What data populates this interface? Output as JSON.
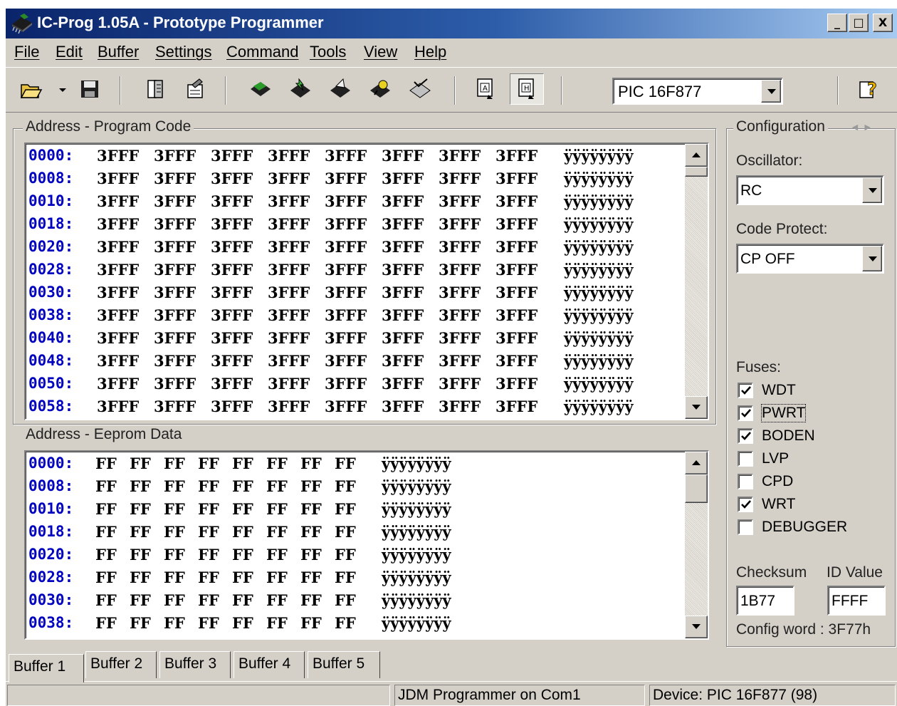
{
  "window": {
    "title": "IC-Prog 1.05A - Prototype Programmer",
    "caption_buttons": [
      "_",
      "□",
      "X"
    ]
  },
  "menu": [
    "File",
    "Edit",
    "Buffer",
    "Settings",
    "Command",
    "Tools",
    "View",
    "Help"
  ],
  "toolbar": {
    "icons": [
      "open-file-icon",
      "open-dropdown-icon",
      "save-icon",
      "read-file-icon",
      "write-file-icon",
      "read-device-icon",
      "program-device-icon",
      "erase-device-icon",
      "verify-device-icon",
      "blank-check-icon",
      "view-asm-icon",
      "view-hex-icon",
      "help-icon"
    ],
    "device": "PIC 16F877"
  },
  "program_code": {
    "title": "Address - Program Code",
    "rows": [
      {
        "addr": "0000:",
        "words": [
          "3FFF",
          "3FFF",
          "3FFF",
          "3FFF",
          "3FFF",
          "3FFF",
          "3FFF",
          "3FFF"
        ],
        "ascii": "ÿÿÿÿÿÿÿÿ"
      },
      {
        "addr": "0008:",
        "words": [
          "3FFF",
          "3FFF",
          "3FFF",
          "3FFF",
          "3FFF",
          "3FFF",
          "3FFF",
          "3FFF"
        ],
        "ascii": "ÿÿÿÿÿÿÿÿ"
      },
      {
        "addr": "0010:",
        "words": [
          "3FFF",
          "3FFF",
          "3FFF",
          "3FFF",
          "3FFF",
          "3FFF",
          "3FFF",
          "3FFF"
        ],
        "ascii": "ÿÿÿÿÿÿÿÿ"
      },
      {
        "addr": "0018:",
        "words": [
          "3FFF",
          "3FFF",
          "3FFF",
          "3FFF",
          "3FFF",
          "3FFF",
          "3FFF",
          "3FFF"
        ],
        "ascii": "ÿÿÿÿÿÿÿÿ"
      },
      {
        "addr": "0020:",
        "words": [
          "3FFF",
          "3FFF",
          "3FFF",
          "3FFF",
          "3FFF",
          "3FFF",
          "3FFF",
          "3FFF"
        ],
        "ascii": "ÿÿÿÿÿÿÿÿ"
      },
      {
        "addr": "0028:",
        "words": [
          "3FFF",
          "3FFF",
          "3FFF",
          "3FFF",
          "3FFF",
          "3FFF",
          "3FFF",
          "3FFF"
        ],
        "ascii": "ÿÿÿÿÿÿÿÿ"
      },
      {
        "addr": "0030:",
        "words": [
          "3FFF",
          "3FFF",
          "3FFF",
          "3FFF",
          "3FFF",
          "3FFF",
          "3FFF",
          "3FFF"
        ],
        "ascii": "ÿÿÿÿÿÿÿÿ"
      },
      {
        "addr": "0038:",
        "words": [
          "3FFF",
          "3FFF",
          "3FFF",
          "3FFF",
          "3FFF",
          "3FFF",
          "3FFF",
          "3FFF"
        ],
        "ascii": "ÿÿÿÿÿÿÿÿ"
      },
      {
        "addr": "0040:",
        "words": [
          "3FFF",
          "3FFF",
          "3FFF",
          "3FFF",
          "3FFF",
          "3FFF",
          "3FFF",
          "3FFF"
        ],
        "ascii": "ÿÿÿÿÿÿÿÿ"
      },
      {
        "addr": "0048:",
        "words": [
          "3FFF",
          "3FFF",
          "3FFF",
          "3FFF",
          "3FFF",
          "3FFF",
          "3FFF",
          "3FFF"
        ],
        "ascii": "ÿÿÿÿÿÿÿÿ"
      },
      {
        "addr": "0050:",
        "words": [
          "3FFF",
          "3FFF",
          "3FFF",
          "3FFF",
          "3FFF",
          "3FFF",
          "3FFF",
          "3FFF"
        ],
        "ascii": "ÿÿÿÿÿÿÿÿ"
      },
      {
        "addr": "0058:",
        "words": [
          "3FFF",
          "3FFF",
          "3FFF",
          "3FFF",
          "3FFF",
          "3FFF",
          "3FFF",
          "3FFF"
        ],
        "ascii": "ÿÿÿÿÿÿÿÿ"
      }
    ]
  },
  "eeprom_data": {
    "title": "Address - Eeprom Data",
    "rows": [
      {
        "addr": "0000:",
        "bytes": [
          "FF",
          "FF",
          "FF",
          "FF",
          "FF",
          "FF",
          "FF",
          "FF"
        ],
        "ascii": "ÿÿÿÿÿÿÿÿ"
      },
      {
        "addr": "0008:",
        "bytes": [
          "FF",
          "FF",
          "FF",
          "FF",
          "FF",
          "FF",
          "FF",
          "FF"
        ],
        "ascii": "ÿÿÿÿÿÿÿÿ"
      },
      {
        "addr": "0010:",
        "bytes": [
          "FF",
          "FF",
          "FF",
          "FF",
          "FF",
          "FF",
          "FF",
          "FF"
        ],
        "ascii": "ÿÿÿÿÿÿÿÿ"
      },
      {
        "addr": "0018:",
        "bytes": [
          "FF",
          "FF",
          "FF",
          "FF",
          "FF",
          "FF",
          "FF",
          "FF"
        ],
        "ascii": "ÿÿÿÿÿÿÿÿ"
      },
      {
        "addr": "0020:",
        "bytes": [
          "FF",
          "FF",
          "FF",
          "FF",
          "FF",
          "FF",
          "FF",
          "FF"
        ],
        "ascii": "ÿÿÿÿÿÿÿÿ"
      },
      {
        "addr": "0028:",
        "bytes": [
          "FF",
          "FF",
          "FF",
          "FF",
          "FF",
          "FF",
          "FF",
          "FF"
        ],
        "ascii": "ÿÿÿÿÿÿÿÿ"
      },
      {
        "addr": "0030:",
        "bytes": [
          "FF",
          "FF",
          "FF",
          "FF",
          "FF",
          "FF",
          "FF",
          "FF"
        ],
        "ascii": "ÿÿÿÿÿÿÿÿ"
      },
      {
        "addr": "0038:",
        "bytes": [
          "FF",
          "FF",
          "FF",
          "FF",
          "FF",
          "FF",
          "FF",
          "FF"
        ],
        "ascii": "ÿÿÿÿÿÿÿÿ"
      }
    ]
  },
  "configuration": {
    "title": "Configuration",
    "oscillator_label": "Oscillator:",
    "oscillator": "RC",
    "code_protect_label": "Code Protect:",
    "code_protect": "CP OFF",
    "fuses_label": "Fuses:",
    "fuses": [
      {
        "name": "WDT",
        "checked": true
      },
      {
        "name": "PWRT",
        "checked": true
      },
      {
        "name": "BODEN",
        "checked": true
      },
      {
        "name": "LVP",
        "checked": false
      },
      {
        "name": "CPD",
        "checked": false
      },
      {
        "name": "WRT",
        "checked": true
      },
      {
        "name": "DEBUGGER",
        "checked": false
      }
    ],
    "checksum_label": "Checksum",
    "checksum": "1B77",
    "id_label": "ID Value",
    "id_value": "FFFF",
    "config_word": "Config word : 3F77h"
  },
  "tabs": [
    "Buffer 1",
    "Buffer 2",
    "Buffer 3",
    "Buffer 4",
    "Buffer 5"
  ],
  "active_tab": 0,
  "status": {
    "left": "",
    "programmer": "JDM Programmer on Com1",
    "device": "Device: PIC 16F877  (98)"
  },
  "colors": {
    "title_gradient_start": "#0a246a",
    "title_gradient_end": "#a6caf0",
    "address_blue": "#0000c0",
    "face": "#d4d0c8"
  }
}
